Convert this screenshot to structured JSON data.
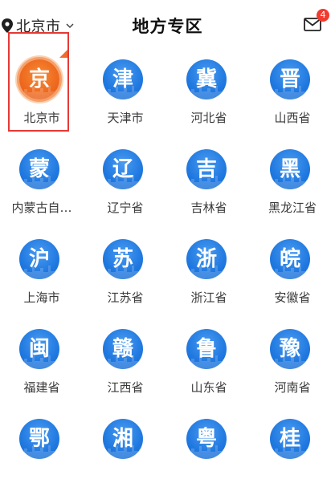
{
  "header": {
    "location": "北京市",
    "title": "地方专区",
    "message_badge": "4",
    "icons": {
      "location": "map-pin-icon",
      "dropdown": "chevron-down-icon",
      "messages": "mail-icon"
    }
  },
  "regions": [
    {
      "glyph": "京",
      "label": "北京市",
      "selected": true
    },
    {
      "glyph": "津",
      "label": "天津市"
    },
    {
      "glyph": "冀",
      "label": "河北省"
    },
    {
      "glyph": "晋",
      "label": "山西省"
    },
    {
      "glyph": "蒙",
      "label": "内蒙古自…"
    },
    {
      "glyph": "辽",
      "label": "辽宁省"
    },
    {
      "glyph": "吉",
      "label": "吉林省"
    },
    {
      "glyph": "黑",
      "label": "黑龙江省"
    },
    {
      "glyph": "沪",
      "label": "上海市"
    },
    {
      "glyph": "苏",
      "label": "江苏省"
    },
    {
      "glyph": "浙",
      "label": "浙江省"
    },
    {
      "glyph": "皖",
      "label": "安徽省"
    },
    {
      "glyph": "闽",
      "label": "福建省"
    },
    {
      "glyph": "赣",
      "label": "江西省"
    },
    {
      "glyph": "鲁",
      "label": "山东省"
    },
    {
      "glyph": "豫",
      "label": "河南省"
    },
    {
      "glyph": "鄂",
      "label": ""
    },
    {
      "glyph": "湘",
      "label": ""
    },
    {
      "glyph": "粤",
      "label": ""
    },
    {
      "glyph": "桂",
      "label": ""
    }
  ],
  "colors": {
    "accent_blue": "#1f78e0",
    "selected_orange": "#ef6b1f",
    "selection_border": "#e53935",
    "badge_red": "#f23b2f"
  }
}
